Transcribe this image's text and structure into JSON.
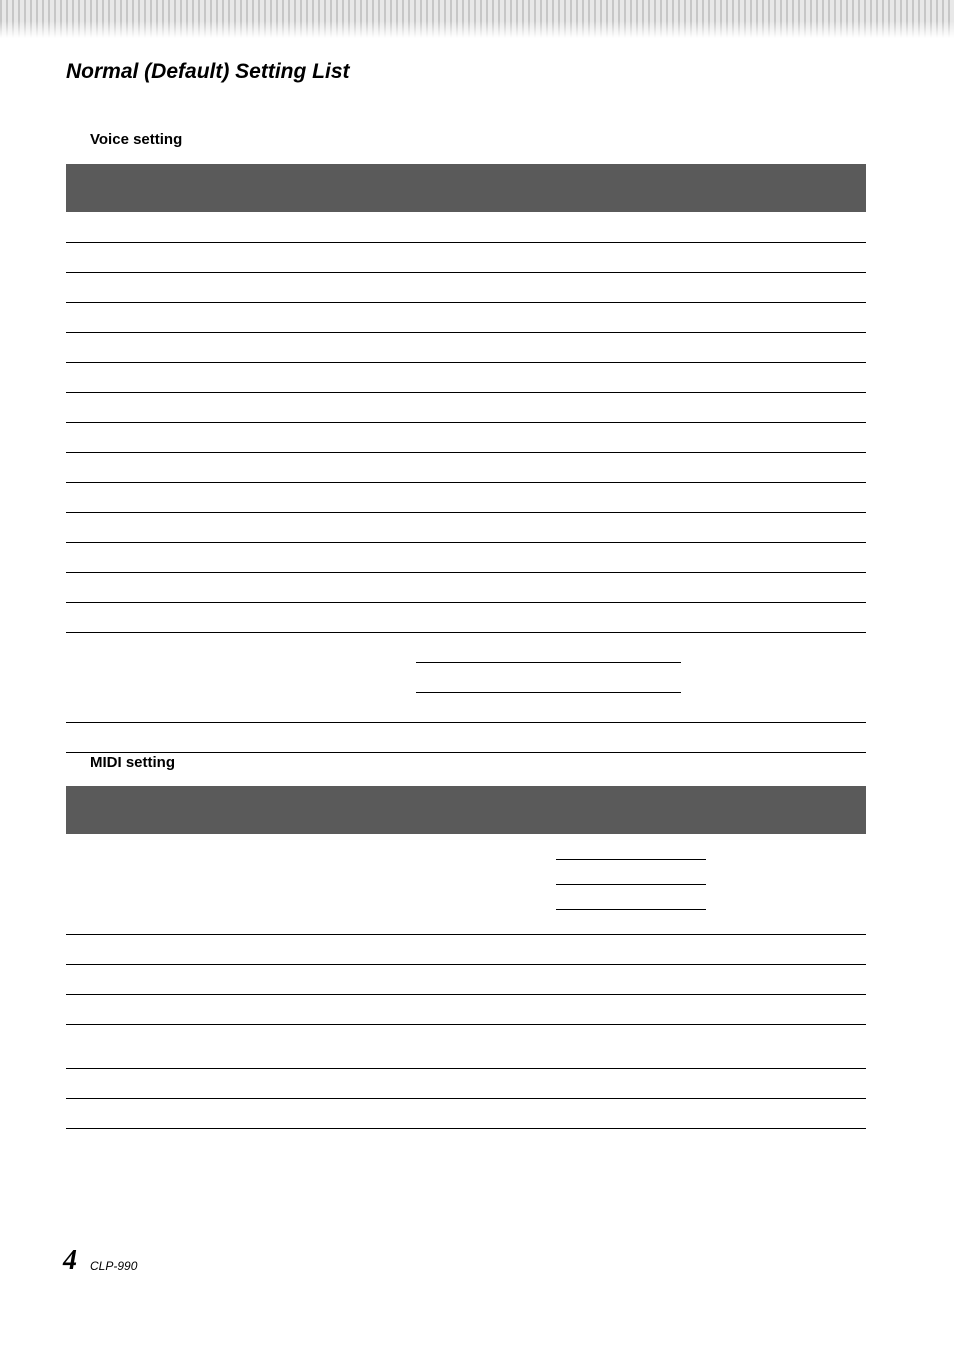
{
  "page_title": "Normal (Default) Setting List",
  "sections": {
    "voice": {
      "heading": "Voice setting"
    },
    "midi": {
      "heading": "MIDI setting"
    }
  },
  "footer": {
    "page_number": "4",
    "model": "CLP-990"
  }
}
